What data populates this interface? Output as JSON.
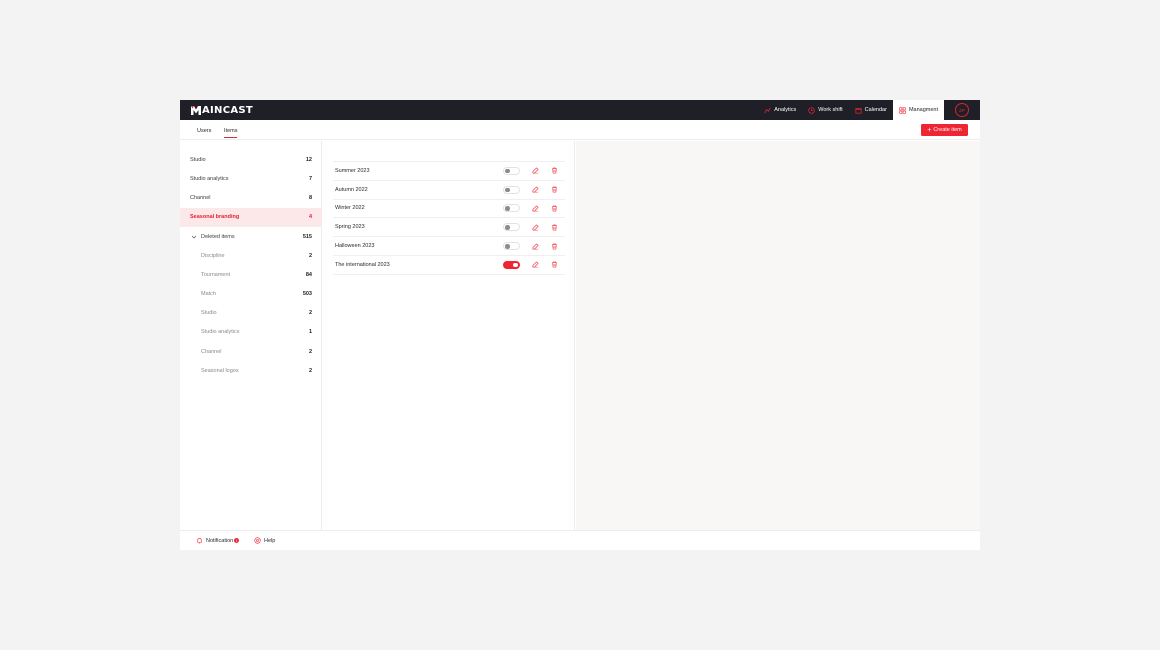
{
  "brand": {
    "logo_text": "AINCAST",
    "accent": "#EE2533",
    "topbar_bg": "#1F2027"
  },
  "nav": [
    {
      "label": "Analytics",
      "icon": "chart-icon"
    },
    {
      "label": "Work shift",
      "icon": "clock-icon"
    },
    {
      "label": "Calendar",
      "icon": "calendar-icon"
    },
    {
      "label": "Managment",
      "icon": "grid-icon",
      "active": true
    }
  ],
  "avatar": {
    "initials": "ZP"
  },
  "tabs": {
    "users": "Users",
    "items": "Items",
    "active": "Items"
  },
  "create_button": "Create item",
  "sidebar": {
    "items": [
      {
        "label": "Studio",
        "count": "12"
      },
      {
        "label": "Studio analytics",
        "count": "7"
      },
      {
        "label": "Channel",
        "count": "8"
      },
      {
        "label": "Seasonal branding",
        "count": "4",
        "active": true
      }
    ],
    "deleted": {
      "label": "Deleted items",
      "count": "515",
      "expanded": true,
      "children": [
        {
          "label": "Discipline",
          "count": "2"
        },
        {
          "label": "Tournament",
          "count": "84"
        },
        {
          "label": "Match",
          "count": "503"
        },
        {
          "label": "Studio",
          "count": "2"
        },
        {
          "label": "Studio analytics",
          "count": "1"
        },
        {
          "label": "Channel",
          "count": "2"
        },
        {
          "label": "Seasonal logos",
          "count": "2"
        }
      ]
    }
  },
  "list": [
    {
      "name": "Summer 2023",
      "enabled": false
    },
    {
      "name": "Autumn 2022",
      "enabled": false
    },
    {
      "name": "Winter 2022",
      "enabled": false
    },
    {
      "name": "Spring 2023",
      "enabled": false
    },
    {
      "name": "Halloween 2023",
      "enabled": false
    },
    {
      "name": "The international 2023",
      "enabled": true
    }
  ],
  "footer": {
    "notification": "Notification",
    "notification_count": "1",
    "help": "Help"
  }
}
